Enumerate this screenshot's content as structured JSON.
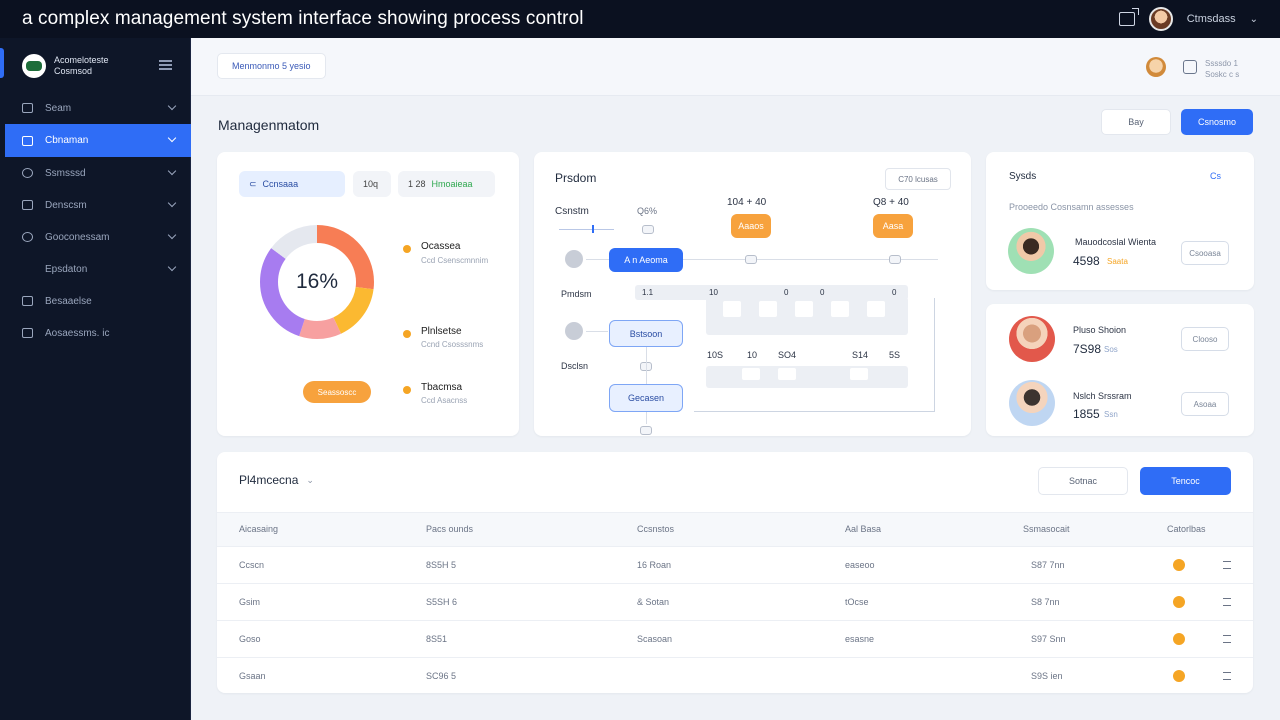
{
  "caption": "a complex management system interface  showing process control",
  "topbar": {
    "user_name": "Ctmsdass"
  },
  "sidebar": {
    "brand_line1": "Acomeloteste",
    "brand_line2": "Cosmsod",
    "items": [
      {
        "label": "Seam",
        "active": false
      },
      {
        "label": "Cbnaman",
        "active": true
      },
      {
        "label": "Ssmsssd",
        "active": false
      },
      {
        "label": "Denscsm",
        "active": false
      },
      {
        "label": "Gooconessam",
        "active": false
      },
      {
        "label": "Epsdaton",
        "active": false
      },
      {
        "label": "Besaaelse",
        "active": false
      },
      {
        "label": "Aosaessms. ic",
        "active": false
      }
    ]
  },
  "subheader": {
    "breadcrumb": "Menmonmo 5 yesio",
    "meta_line1": "Ssssdo    1",
    "meta_line2": "Soskc  c s"
  },
  "page": {
    "title": "Managenmatom",
    "btn_secondary": "Bay",
    "btn_primary": "Csnosmo"
  },
  "donut_card": {
    "pill_search": "Ccnsaaa",
    "pill_value": "10q",
    "pill_status_num": "1 28",
    "pill_status_text": "Hmoaieaa",
    "center_value": "16%",
    "segments": [
      {
        "value": 0.27,
        "color": "#f77d55"
      },
      {
        "value": 0.16,
        "color": "#fbb931"
      },
      {
        "value": 0.12,
        "color": "#f7a0a0"
      },
      {
        "value": 0.3,
        "color": "#a77cf0"
      },
      {
        "value": 0.15,
        "color": "#e5e8ef"
      }
    ],
    "legend": [
      {
        "title": "Ocassea",
        "sub": "Ccd Csenscmnnim"
      },
      {
        "title": "Plnlsetse",
        "sub": "Ccnd Csosssnms"
      },
      {
        "title": "Tbacmsa",
        "sub": "Ccd Asacnss"
      }
    ],
    "orange_pill": "Seassoscc"
  },
  "process_card": {
    "title": "Prsdom",
    "select": "C70  lcusas",
    "col_caps": [
      "Csnstm",
      "Q6%",
      "104 + 40",
      "Q8 + 40"
    ],
    "row_labels": [
      "Pmdsm",
      "Dsclsn"
    ],
    "nodes": {
      "blue_node": "A n Aeoma",
      "orange_1": "Aaaos",
      "orange_2": "Aasa",
      "light_1": "Bstsoon",
      "light_2": "Gecasen"
    },
    "grid_top": [
      "1.1",
      "10",
      "0",
      "0",
      "0"
    ],
    "grid_mid": [
      "10S",
      "10",
      "SO4",
      "S14",
      "5S"
    ]
  },
  "people_card": {
    "title": "Sysds",
    "link": "Cs",
    "subtitle": "Prooeedo Cosnsamn assesses",
    "people": [
      {
        "name": "Mauodcoslal Wienta",
        "amount": "4598",
        "tag": "Saata",
        "btn": "Csooasa"
      },
      {
        "name": "Pluso Shoion",
        "amount": "7S98",
        "tag": "Sos",
        "btn": "Clooso"
      },
      {
        "name": "Nslch Srssram",
        "amount": "1855",
        "tag": "Ssn",
        "btn": "Asoaa"
      }
    ]
  },
  "table": {
    "title": "Pl4mcecna",
    "btn_secondary": "Sotnac",
    "btn_primary": "Tencoc",
    "columns": [
      "Aicasaing",
      "Pacs ounds",
      "Ccsnstos",
      "Aal Basa",
      "Ssmasocait",
      "Catorlbas"
    ],
    "rows": [
      [
        "Ccscn",
        "8S5H 5",
        "16 Roan",
        "easeoo",
        "S87 7nn"
      ],
      [
        "Gsim",
        "S5SH 6",
        "& Sotan",
        "tOcse",
        "S8 7nn"
      ],
      [
        "Goso",
        "8S51",
        "Scasoan",
        "esasne",
        "S97 Snn"
      ],
      [
        "Gsaan",
        "SC96 5",
        "",
        "",
        "S9S ien"
      ]
    ]
  }
}
